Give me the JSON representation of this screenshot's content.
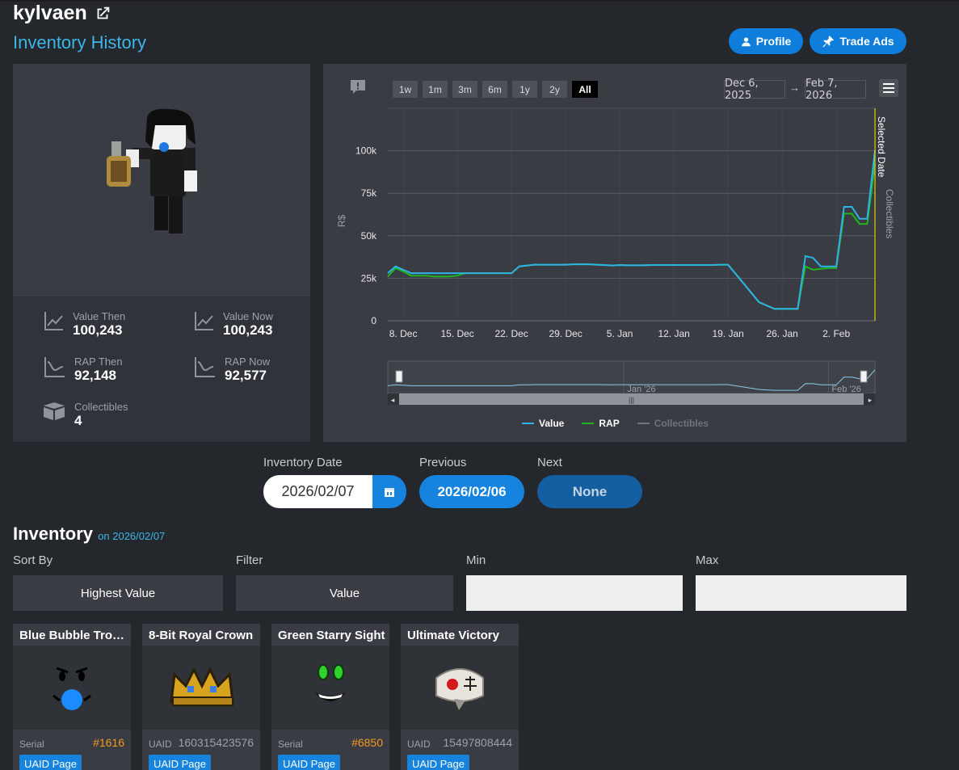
{
  "header": {
    "username": "kylvaen",
    "subtitle": "Inventory History",
    "profile_label": "Profile",
    "trade_ads_label": "Trade Ads"
  },
  "stats": {
    "value_then_label": "Value Then",
    "value_then": "100,243",
    "value_now_label": "Value Now",
    "value_now": "100,243",
    "rap_then_label": "RAP Then",
    "rap_then": "92,148",
    "rap_now_label": "RAP Now",
    "rap_now": "92,577",
    "collectibles_label": "Collectibles",
    "collectibles": "4"
  },
  "chart_controls": {
    "ranges": [
      "1w",
      "1m",
      "3m",
      "6m",
      "1y",
      "2y",
      "All"
    ],
    "active_range": "All",
    "from_date": "Dec 6, 2025",
    "arrow": "→",
    "to_date": "Feb 7, 2026"
  },
  "chart_data": {
    "type": "line",
    "ylabel": "R$",
    "ylim": [
      0,
      125000
    ],
    "yticks": [
      0,
      25000,
      50000,
      75000,
      100000
    ],
    "ytick_labels": [
      "0",
      "25k",
      "50k",
      "75k",
      "100k"
    ],
    "x_tick_labels": [
      "8. Dec",
      "15. Dec",
      "22. Dec",
      "29. Dec",
      "5. Jan",
      "12. Jan",
      "19. Jan",
      "26. Jan",
      "2. Feb"
    ],
    "x_tick_days": [
      2,
      9,
      16,
      23,
      30,
      37,
      44,
      51,
      58
    ],
    "x_domain_days": [
      0,
      63
    ],
    "x_units": "days from Dec 6, 2025",
    "series": [
      {
        "name": "Value",
        "color": "#2fb3e6",
        "x": [
          0,
          1,
          2,
          3,
          4,
          5,
          6,
          7,
          8,
          9,
          10,
          11,
          12,
          13,
          14,
          15,
          16,
          17,
          18,
          19,
          20,
          21,
          22,
          23,
          24,
          25,
          26,
          27,
          28,
          29,
          30,
          31,
          32,
          33,
          34,
          35,
          36,
          37,
          38,
          39,
          40,
          41,
          42,
          43,
          44,
          46,
          48,
          50,
          52,
          53,
          54,
          55,
          56,
          57,
          58,
          59,
          60,
          61,
          62,
          63
        ],
        "y": [
          28000,
          32000,
          30000,
          28000,
          28000,
          28000,
          28000,
          28000,
          28000,
          28000,
          28000,
          28000,
          28000,
          28000,
          28000,
          28000,
          28000,
          32000,
          32500,
          33000,
          33000,
          33000,
          33000,
          33000,
          33200,
          33200,
          33200,
          33000,
          32800,
          32500,
          32800,
          32600,
          32600,
          32600,
          32800,
          32800,
          32800,
          32800,
          32800,
          32800,
          32800,
          32800,
          32800,
          33000,
          33000,
          22000,
          11000,
          7000,
          7000,
          7000,
          38000,
          37000,
          32000,
          32000,
          32000,
          67000,
          67000,
          60000,
          60000,
          100243
        ]
      },
      {
        "name": "RAP",
        "color": "#21b421",
        "x": [
          0,
          1,
          2,
          3,
          4,
          5,
          6,
          7,
          8,
          9,
          10,
          11,
          12,
          13,
          14,
          15,
          16,
          17,
          18,
          19,
          20,
          21,
          22,
          23,
          24,
          25,
          26,
          27,
          28,
          29,
          30,
          31,
          32,
          33,
          34,
          35,
          36,
          37,
          38,
          39,
          40,
          41,
          42,
          43,
          44,
          46,
          48,
          50,
          52,
          53,
          54,
          55,
          56,
          57,
          58,
          59,
          60,
          61,
          62,
          63
        ],
        "y": [
          26000,
          31000,
          29000,
          26500,
          26500,
          26500,
          26000,
          26000,
          26000,
          26500,
          28000,
          28000,
          28000,
          28000,
          28000,
          28000,
          28000,
          32000,
          32500,
          33000,
          33000,
          33000,
          33000,
          33000,
          33200,
          33200,
          33200,
          33000,
          32800,
          32500,
          32800,
          32600,
          32600,
          32600,
          32800,
          32800,
          32800,
          32800,
          32800,
          32800,
          32800,
          32800,
          32800,
          33000,
          33000,
          22000,
          11000,
          7000,
          7000,
          7000,
          32000,
          30000,
          30500,
          31000,
          31000,
          63000,
          63000,
          57000,
          57000,
          92577
        ]
      },
      {
        "name": "Collectibles",
        "color": "#666b72",
        "x": [],
        "y": []
      }
    ],
    "flag_label": "Selected Date",
    "side_label": "Collectibles",
    "navigator_labels": [
      "Jan '26",
      "Feb '26"
    ],
    "legend": [
      "Value",
      "RAP",
      "Collectibles"
    ],
    "grid": true
  },
  "date_nav": {
    "inventory_date_label": "Inventory Date",
    "inventory_date": "2026/02/07",
    "previous_label": "Previous",
    "previous_date": "2026/02/06",
    "next_label": "Next",
    "next_value": "None"
  },
  "inventory": {
    "title": "Inventory",
    "on_text": "on 2026/02/07",
    "sort_by_label": "Sort By",
    "sort_by_value": "Highest Value",
    "filter_label": "Filter",
    "filter_value": "Value",
    "min_label": "Min",
    "max_label": "Max",
    "cards": [
      {
        "title": "Blue Bubble Trou...",
        "id_label": "Serial",
        "id_value": "#1616",
        "button": "UAID Page",
        "value_color": "#f39a1f"
      },
      {
        "title": "8-Bit Royal Crown",
        "id_label": "UAID",
        "id_value": "160315423576",
        "button": "UAID Page",
        "value_color": "#9ca1a8"
      },
      {
        "title": "Green Starry Sight",
        "id_label": "Serial",
        "id_value": "#6850",
        "button": "UAID Page",
        "value_color": "#f39a1f"
      },
      {
        "title": "Ultimate Victory",
        "id_label": "UAID",
        "id_value": "15497808444",
        "button": "UAID Page",
        "value_color": "#9ca1a8"
      }
    ]
  },
  "colors": {
    "accent": "#0f7ddb",
    "link": "#3db6e8",
    "panel": "#393c42",
    "background": "#24272c"
  }
}
